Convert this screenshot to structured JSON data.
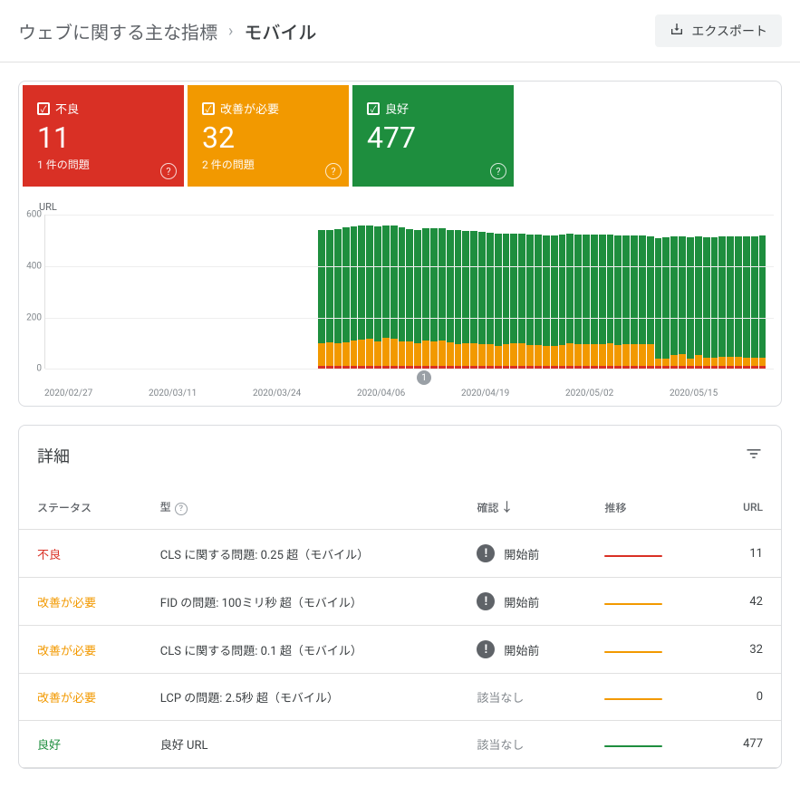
{
  "breadcrumb": {
    "parent": "ウェブに関する主な指標",
    "current": "モバイル"
  },
  "export_label": "エクスポート",
  "tiles": {
    "poor": {
      "label": "不良",
      "count": "11",
      "issues": "1 件の問題"
    },
    "need": {
      "label": "改善が必要",
      "count": "32",
      "issues": "2 件の問題"
    },
    "good": {
      "label": "良好",
      "count": "477",
      "issues": ""
    }
  },
  "chart_data": {
    "type": "bar",
    "ylabel": "URL",
    "ylim": [
      0,
      600
    ],
    "yticks": [
      0,
      200,
      400,
      600
    ],
    "xlabels": [
      "2020/02/27",
      "2020/03/11",
      "2020/03/24",
      "2020/04/06",
      "2020/04/19",
      "2020/05/02",
      "2020/05/15"
    ],
    "annotation_badge": "1",
    "series_names": [
      "不良",
      "改善が必要",
      "良好"
    ],
    "bars": [
      {
        "poor": 0,
        "need": 0,
        "good": 0
      },
      {
        "poor": 0,
        "need": 0,
        "good": 0
      },
      {
        "poor": 0,
        "need": 0,
        "good": 0
      },
      {
        "poor": 0,
        "need": 0,
        "good": 0
      },
      {
        "poor": 0,
        "need": 0,
        "good": 0
      },
      {
        "poor": 0,
        "need": 0,
        "good": 0
      },
      {
        "poor": 0,
        "need": 0,
        "good": 0
      },
      {
        "poor": 0,
        "need": 0,
        "good": 0
      },
      {
        "poor": 0,
        "need": 0,
        "good": 0
      },
      {
        "poor": 0,
        "need": 0,
        "good": 0
      },
      {
        "poor": 0,
        "need": 0,
        "good": 0
      },
      {
        "poor": 0,
        "need": 0,
        "good": 0
      },
      {
        "poor": 0,
        "need": 0,
        "good": 0
      },
      {
        "poor": 0,
        "need": 0,
        "good": 0
      },
      {
        "poor": 0,
        "need": 0,
        "good": 0
      },
      {
        "poor": 0,
        "need": 0,
        "good": 0
      },
      {
        "poor": 0,
        "need": 0,
        "good": 0
      },
      {
        "poor": 0,
        "need": 0,
        "good": 0
      },
      {
        "poor": 0,
        "need": 0,
        "good": 0
      },
      {
        "poor": 0,
        "need": 0,
        "good": 0
      },
      {
        "poor": 0,
        "need": 0,
        "good": 0
      },
      {
        "poor": 0,
        "need": 0,
        "good": 0
      },
      {
        "poor": 0,
        "need": 0,
        "good": 0
      },
      {
        "poor": 0,
        "need": 0,
        "good": 0
      },
      {
        "poor": 0,
        "need": 0,
        "good": 0
      },
      {
        "poor": 0,
        "need": 0,
        "good": 0
      },
      {
        "poor": 0,
        "need": 0,
        "good": 0
      },
      {
        "poor": 0,
        "need": 0,
        "good": 0
      },
      {
        "poor": 0,
        "need": 0,
        "good": 0
      },
      {
        "poor": 0,
        "need": 0,
        "good": 0
      },
      {
        "poor": 0,
        "need": 0,
        "good": 0
      },
      {
        "poor": 0,
        "need": 0,
        "good": 0
      },
      {
        "poor": 0,
        "need": 0,
        "good": 0
      },
      {
        "poor": 0,
        "need": 0,
        "good": 0
      },
      {
        "poor": 11,
        "need": 90,
        "good": 440
      },
      {
        "poor": 11,
        "need": 92,
        "good": 440
      },
      {
        "poor": 11,
        "need": 88,
        "good": 445
      },
      {
        "poor": 11,
        "need": 93,
        "good": 448
      },
      {
        "poor": 11,
        "need": 100,
        "good": 445
      },
      {
        "poor": 11,
        "need": 105,
        "good": 442
      },
      {
        "poor": 11,
        "need": 108,
        "good": 440
      },
      {
        "poor": 11,
        "need": 95,
        "good": 450
      },
      {
        "poor": 11,
        "need": 110,
        "good": 438
      },
      {
        "poor": 11,
        "need": 108,
        "good": 440
      },
      {
        "poor": 11,
        "need": 95,
        "good": 445
      },
      {
        "poor": 11,
        "need": 95,
        "good": 440
      },
      {
        "poor": 11,
        "need": 90,
        "good": 442
      },
      {
        "poor": 11,
        "need": 100,
        "good": 438
      },
      {
        "poor": 11,
        "need": 96,
        "good": 440
      },
      {
        "poor": 11,
        "need": 100,
        "good": 438
      },
      {
        "poor": 11,
        "need": 92,
        "good": 440
      },
      {
        "poor": 11,
        "need": 85,
        "good": 445
      },
      {
        "poor": 11,
        "need": 88,
        "good": 440
      },
      {
        "poor": 11,
        "need": 90,
        "good": 438
      },
      {
        "poor": 11,
        "need": 84,
        "good": 438
      },
      {
        "poor": 11,
        "need": 85,
        "good": 435
      },
      {
        "poor": 11,
        "need": 80,
        "good": 438
      },
      {
        "poor": 11,
        "need": 86,
        "good": 430
      },
      {
        "poor": 11,
        "need": 88,
        "good": 430
      },
      {
        "poor": 11,
        "need": 88,
        "good": 428
      },
      {
        "poor": 11,
        "need": 82,
        "good": 430
      },
      {
        "poor": 11,
        "need": 82,
        "good": 432
      },
      {
        "poor": 11,
        "need": 80,
        "good": 430
      },
      {
        "poor": 11,
        "need": 78,
        "good": 432
      },
      {
        "poor": 11,
        "need": 82,
        "good": 430
      },
      {
        "poor": 11,
        "need": 88,
        "good": 428
      },
      {
        "poor": 11,
        "need": 86,
        "good": 428
      },
      {
        "poor": 11,
        "need": 85,
        "good": 428
      },
      {
        "poor": 11,
        "need": 84,
        "good": 428
      },
      {
        "poor": 11,
        "need": 86,
        "good": 428
      },
      {
        "poor": 11,
        "need": 88,
        "good": 425
      },
      {
        "poor": 11,
        "need": 83,
        "good": 425
      },
      {
        "poor": 11,
        "need": 85,
        "good": 425
      },
      {
        "poor": 11,
        "need": 84,
        "good": 424
      },
      {
        "poor": 11,
        "need": 85,
        "good": 425
      },
      {
        "poor": 11,
        "need": 84,
        "good": 423
      },
      {
        "poor": 11,
        "need": 30,
        "good": 470
      },
      {
        "poor": 11,
        "need": 28,
        "good": 475
      },
      {
        "poor": 11,
        "need": 45,
        "good": 460
      },
      {
        "poor": 11,
        "need": 46,
        "good": 458
      },
      {
        "poor": 11,
        "need": 30,
        "good": 472
      },
      {
        "poor": 11,
        "need": 45,
        "good": 460
      },
      {
        "poor": 11,
        "need": 34,
        "good": 468
      },
      {
        "poor": 11,
        "need": 32,
        "good": 472
      },
      {
        "poor": 11,
        "need": 38,
        "good": 468
      },
      {
        "poor": 11,
        "need": 36,
        "good": 470
      },
      {
        "poor": 11,
        "need": 35,
        "good": 470
      },
      {
        "poor": 11,
        "need": 34,
        "good": 472
      },
      {
        "poor": 11,
        "need": 32,
        "good": 474
      },
      {
        "poor": 11,
        "need": 32,
        "good": 477
      }
    ]
  },
  "details": {
    "title": "詳細",
    "columns": {
      "status": "ステータス",
      "type": "型",
      "confirm": "確認",
      "trend": "推移",
      "url": "URL"
    },
    "rows": [
      {
        "status": "不良",
        "status_class": "st-poor",
        "type": "CLS に関する問題: 0.25 超（モバイル）",
        "confirm_icon": true,
        "confirm": "開始前",
        "spark": "#d93025",
        "url": "11"
      },
      {
        "status": "改善が必要",
        "status_class": "st-need",
        "type": "FID の問題: 100ミリ秒 超（モバイル）",
        "confirm_icon": true,
        "confirm": "開始前",
        "spark": "#f29900",
        "url": "42"
      },
      {
        "status": "改善が必要",
        "status_class": "st-need",
        "type": "CLS に関する問題: 0.1 超（モバイル）",
        "confirm_icon": true,
        "confirm": "開始前",
        "spark": "#f29900",
        "url": "32"
      },
      {
        "status": "改善が必要",
        "status_class": "st-need",
        "type": "LCP の問題: 2.5秒 超（モバイル）",
        "confirm_icon": false,
        "confirm": "該当なし",
        "spark": "#f29900",
        "url": "0"
      },
      {
        "status": "良好",
        "status_class": "st-good",
        "type": "良好 URL",
        "confirm_icon": false,
        "confirm": "該当なし",
        "spark": "#1e8e3e",
        "url": "477"
      }
    ]
  }
}
